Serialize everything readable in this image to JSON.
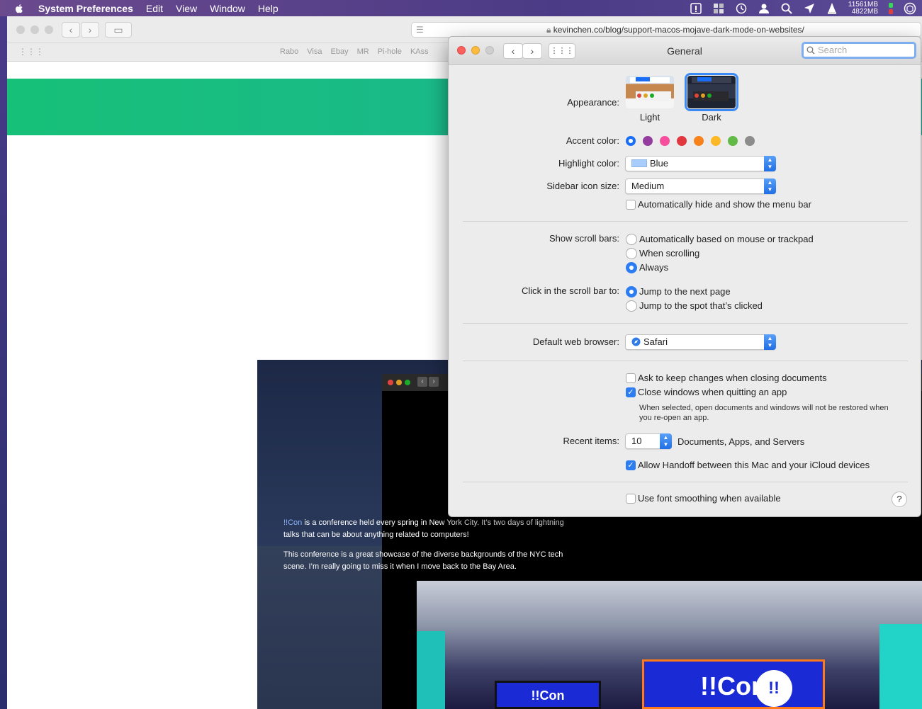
{
  "menubar": {
    "app": "System Preferences",
    "items": [
      "Edit",
      "View",
      "Window",
      "Help"
    ],
    "memory_top": "11561MB",
    "memory_bottom": "4822MB"
  },
  "safari": {
    "url": "kevinchen.co/blog/support-macos-mojave-dark-mode-on-websites/",
    "favorites": [
      "Rabo",
      "Visa",
      "Ebay",
      "MR",
      "Pi-hole",
      "KAss"
    ]
  },
  "blog": {
    "link": "!!Con",
    "p1_rest": " is a conference held every spring in New York City. It’s two days of lightning talks that can be about anything related to computers!",
    "p2": "This conference is a great showcase of the diverse backgrounds of the NYC tech scene. I’m really going to miss it when I move back to the Bay Area.",
    "screen_text_left": "!!Con",
    "screen_text_right": "!!Con",
    "badge": "!!"
  },
  "prefs": {
    "title": "General",
    "search_placeholder": "Search",
    "appearance": {
      "label": "Appearance:",
      "options": [
        "Light",
        "Dark"
      ],
      "selected": "Dark"
    },
    "accent": {
      "label": "Accent color:",
      "colors": [
        "#1a6ef5",
        "#953d9f",
        "#f74f9e",
        "#e0383e",
        "#f7821b",
        "#fcb827",
        "#62ba46",
        "#8c8c8c"
      ],
      "selected": 0
    },
    "highlight": {
      "label": "Highlight color:",
      "value": "Blue",
      "swatch": "#a8cdfc"
    },
    "sidebar_icon": {
      "label": "Sidebar icon size:",
      "value": "Medium"
    },
    "auto_hide_menu": {
      "label": "Automatically hide and show the menu bar",
      "checked": false
    },
    "scroll_bars": {
      "label": "Show scroll bars:",
      "options": [
        "Automatically based on mouse or trackpad",
        "When scrolling",
        "Always"
      ],
      "selected": 2
    },
    "click_scroll": {
      "label": "Click in the scroll bar to:",
      "options": [
        "Jump to the next page",
        "Jump to the spot that’s clicked"
      ],
      "selected": 0
    },
    "browser": {
      "label": "Default web browser:",
      "value": "Safari"
    },
    "ask_keep": {
      "label": "Ask to keep changes when closing documents",
      "checked": false
    },
    "close_windows": {
      "label": "Close windows when quitting an app",
      "checked": true
    },
    "close_note": "When selected, open documents and windows will not be restored when you re-open an app.",
    "recent": {
      "label": "Recent items:",
      "value": "10",
      "suffix": "Documents, Apps, and Servers"
    },
    "handoff": {
      "label": "Allow Handoff between this Mac and your iCloud devices",
      "checked": true
    },
    "font_smoothing": {
      "label": "Use font smoothing when available",
      "checked": false
    },
    "help": "?"
  }
}
